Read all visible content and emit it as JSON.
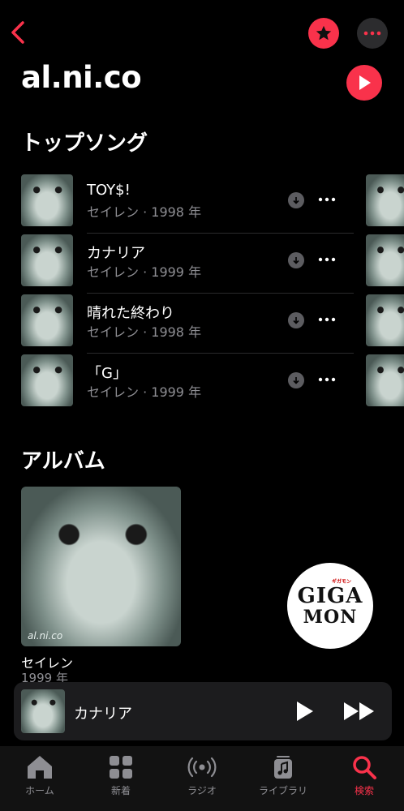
{
  "artist": {
    "name": "al.ni.co"
  },
  "sections": {
    "top_songs": "トップソング",
    "albums": "アルバム"
  },
  "songs": [
    {
      "title": "TOY$!",
      "subtitle": "セイレン · 1998 年"
    },
    {
      "title": "カナリア",
      "subtitle": "セイレン · 1999 年"
    },
    {
      "title": "晴れた終わり",
      "subtitle": "セイレン · 1998 年"
    },
    {
      "title": "「G」",
      "subtitle": "セイレン · 1999 年"
    }
  ],
  "album": {
    "title": "セイレン",
    "year": "1999 年",
    "art_text": "al.ni.co"
  },
  "badge": {
    "line1": "GIGA",
    "line2": "MON",
    "kana": "ギガモン"
  },
  "mini_player": {
    "title": "カナリア"
  },
  "tabs": [
    {
      "label": "ホーム",
      "icon": "home-icon"
    },
    {
      "label": "新着",
      "icon": "grid-icon"
    },
    {
      "label": "ラジオ",
      "icon": "radio-icon"
    },
    {
      "label": "ライブラリ",
      "icon": "library-icon"
    },
    {
      "label": "検索",
      "icon": "search-icon",
      "active": true
    }
  ],
  "colors": {
    "accent": "#f9324b",
    "background": "#000000",
    "secondary_text": "#8e8e93"
  }
}
